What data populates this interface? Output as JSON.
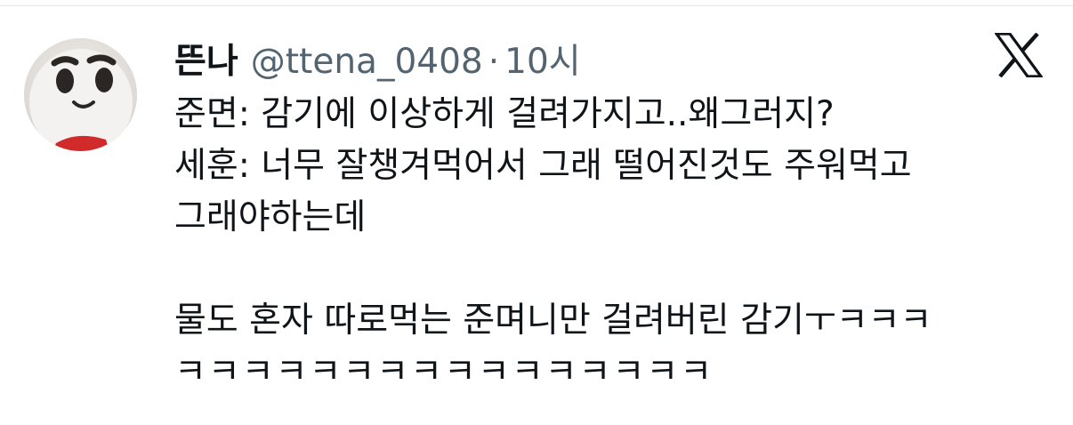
{
  "tweet": {
    "author": {
      "display_name": "뜬나",
      "handle": "@ttena_0408",
      "avatar": "avatar"
    },
    "separator": "·",
    "time": "10시",
    "platform_icon": "x-logo-icon",
    "lines": [
      "준면: 감기에 이상하게 걸려가지고..왜그러지?",
      "세훈: 너무 잘챙겨먹어서 그래 떨어진것도 주워먹고",
      "그래야하는데",
      "물도 혼자 따로먹는 준며니만 걸려버린 감기ㅜㅋㅋㅋ",
      "ㅋㅋㅋㅋㅋㅋㅋㅋㅋㅋㅋㅋㅋㅋㅋㅋ"
    ]
  },
  "colors": {
    "text_primary": "#0f1419",
    "text_secondary": "#536471",
    "background": "#ffffff"
  }
}
